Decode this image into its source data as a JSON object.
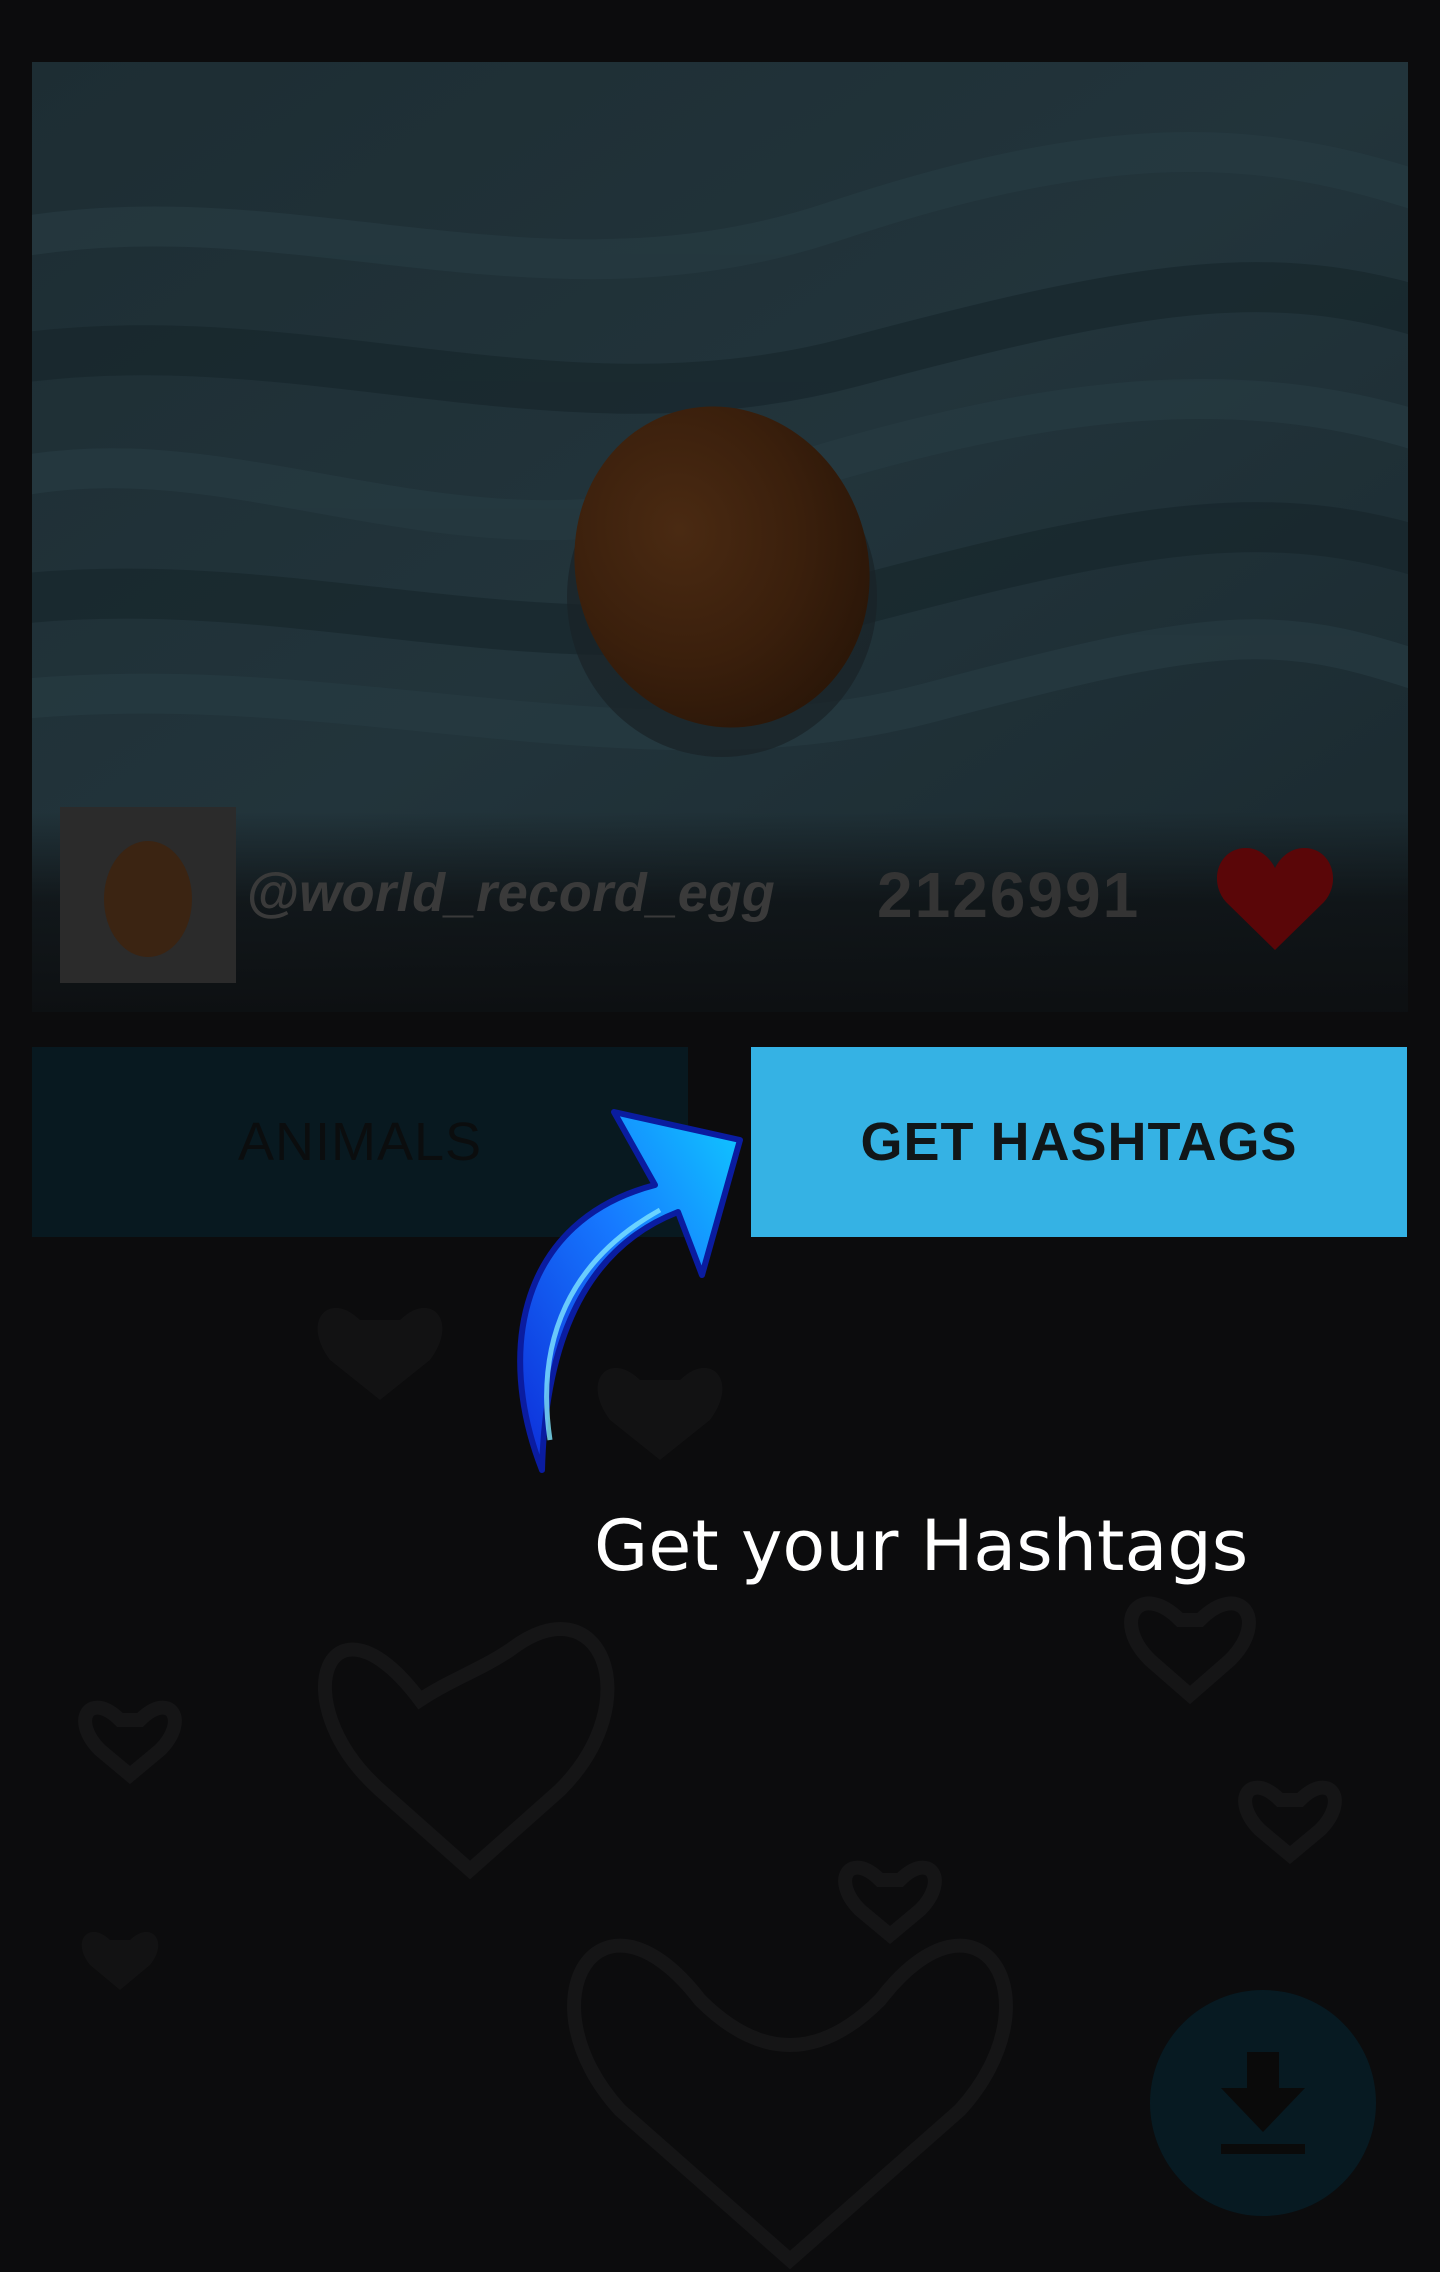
{
  "post": {
    "username": "@world_record_egg",
    "likes": "2126991",
    "liked": true,
    "image_subject": "egg on dark towel"
  },
  "buttons": {
    "category_label": "ANIMALS",
    "get_hashtags_label": "GET HASHTAGS"
  },
  "tutorial": {
    "hint_text": "Get your Hashtags"
  },
  "fab": {
    "icon": "download-icon"
  },
  "colors": {
    "accent": "#35b2e4",
    "heart": "#5a0608",
    "background": "#0c0c0d"
  }
}
